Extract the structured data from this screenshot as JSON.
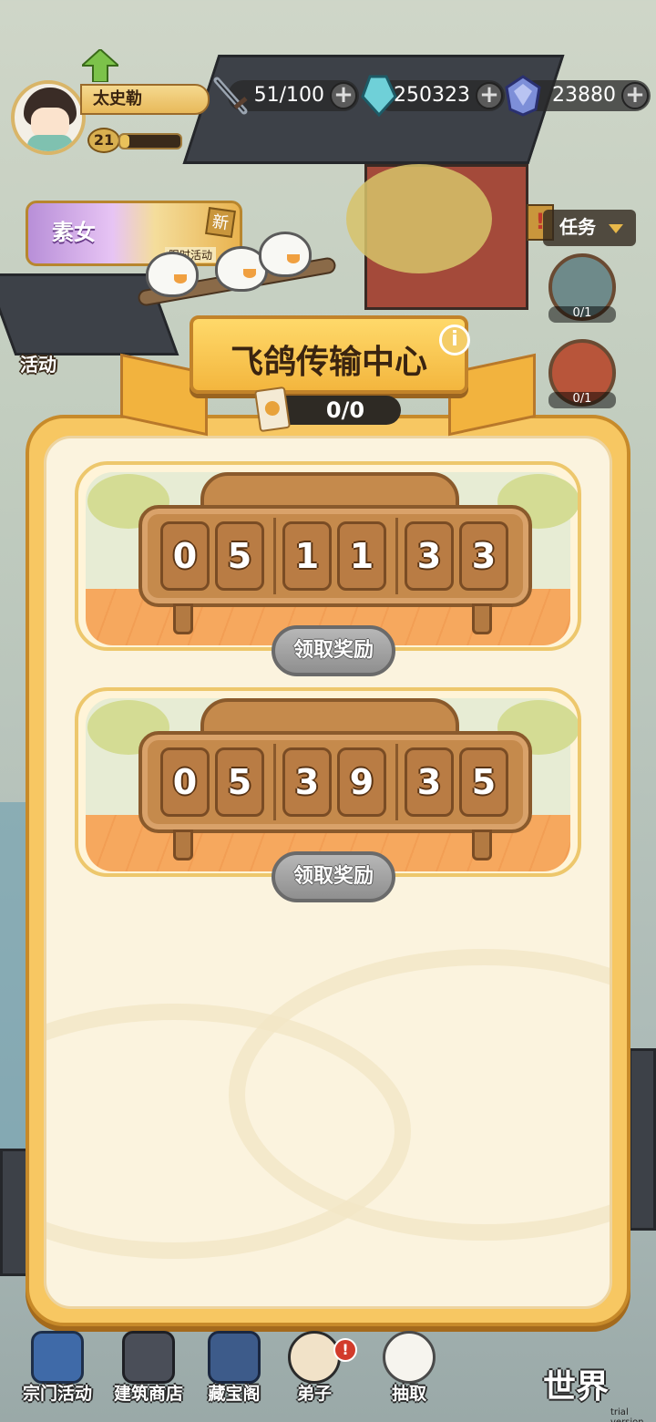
{
  "player": {
    "name": "太史勒",
    "level": "21",
    "exp_fraction": 0.15
  },
  "resources": [
    {
      "icon": "sword-icon",
      "value": "51/100"
    },
    {
      "icon": "crystal-icon",
      "value": "250323"
    },
    {
      "icon": "gem-icon",
      "value": "23880"
    }
  ],
  "left_menu": {
    "event_title": "素女",
    "event_subtitle": "限时活动",
    "event_new_badge": "新",
    "activity_label": "活动"
  },
  "right_menu": {
    "task_label": "任务",
    "task_alert": "!",
    "quest_counts": [
      "0/1",
      "0/1"
    ]
  },
  "panel": {
    "title": "飞鸽传输中心",
    "info_icon": "i",
    "counter": "0/0",
    "cards": [
      {
        "code": [
          "0",
          "5",
          "1",
          "1",
          "3",
          "3"
        ],
        "claim_label": "领取奖励"
      },
      {
        "code": [
          "0",
          "5",
          "3",
          "9",
          "3",
          "5"
        ],
        "claim_label": "领取奖励"
      }
    ]
  },
  "bottom_nav": {
    "items": [
      {
        "label": "宗门活动",
        "icon": "pagoda-icon"
      },
      {
        "label": "建筑商店",
        "icon": "building-icon"
      },
      {
        "label": "藏宝阁",
        "icon": "treasure-pavilion-icon"
      },
      {
        "label": "弟子",
        "icon": "disciple-icon",
        "alert": "!"
      },
      {
        "label": "抽取",
        "icon": "bird-icon"
      }
    ],
    "world_label": "世界"
  },
  "watermark": "trial version",
  "colors": {
    "panel_gold": "#f7c762",
    "panel_cream": "#fbf3de",
    "board_brown": "#c58a4c",
    "button_gray": "#8f8f8f"
  }
}
